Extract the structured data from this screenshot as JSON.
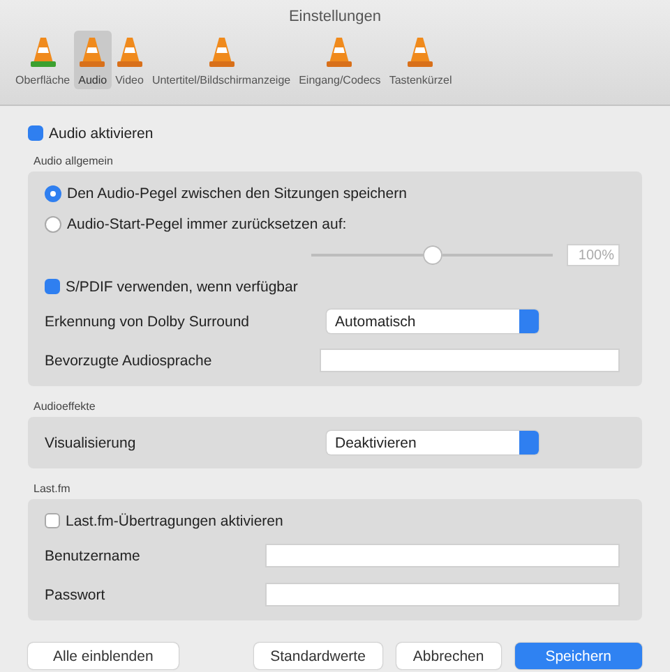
{
  "window": {
    "title": "Einstellungen"
  },
  "tabs": [
    {
      "label": "Oberfläche",
      "selected": false
    },
    {
      "label": "Audio",
      "selected": true
    },
    {
      "label": "Video",
      "selected": false
    },
    {
      "label": "Untertitel/Bildschirmanzeige",
      "selected": false
    },
    {
      "label": "Eingang/Codecs",
      "selected": false
    },
    {
      "label": "Tastenkürzel",
      "selected": false
    }
  ],
  "enable_audio": {
    "label": "Audio aktivieren",
    "checked": true
  },
  "general": {
    "title": "Audio allgemein",
    "radios": [
      {
        "label": "Den Audio-Pegel zwischen den Sitzungen speichern",
        "selected": true
      },
      {
        "label": "Audio-Start-Pegel immer zurücksetzen auf:",
        "selected": false
      }
    ],
    "volume": {
      "level": 0.5,
      "reading": "100%"
    },
    "spdif": {
      "label": "S/PDIF verwenden, wenn verfügbar",
      "checked": true
    },
    "dolby": {
      "label": "Erkennung von Dolby Surround",
      "value": "Automatisch"
    },
    "language": {
      "label": "Bevorzugte Audiosprache"
    }
  },
  "effects": {
    "title": "Audioeffekte",
    "visualization": {
      "label": "Visualisierung",
      "value": "Deaktivieren"
    }
  },
  "lastfm": {
    "title": "Last.fm",
    "enable": {
      "label": "Last.fm-Übertragungen aktivieren",
      "checked": false
    },
    "username": {
      "label": "Benutzername"
    },
    "password": {
      "label": "Passwort"
    }
  },
  "buttons": [
    {
      "label": "Alle einblenden",
      "kind": "plain"
    },
    {
      "label": "Standardwerte",
      "kind": "plain"
    },
    {
      "label": "Abbrechen",
      "kind": "plain"
    },
    {
      "label": "Speichern",
      "kind": "primary"
    }
  ]
}
